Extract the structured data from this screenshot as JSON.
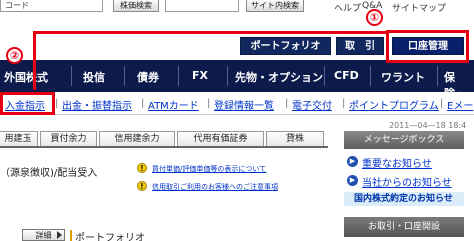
{
  "topbar": {
    "code_input_value": "コード",
    "stock_search_label": "株価検索",
    "site_search_label": "サイト内検索",
    "help": "ヘルプ",
    "qa": "Q&A",
    "sitemap": "サイトマップ"
  },
  "tabs": {
    "portfolio": "ポートフォリオ",
    "torihiki": "取　引",
    "koza": "口座管理"
  },
  "mainnav": [
    "外国株式",
    "投信",
    "債券",
    "FX",
    "先物・オプション",
    "CFD",
    "ワラント",
    "保険・"
  ],
  "subnav": [
    "入金指示",
    "出金・振替指示",
    "ATMカード",
    "登録情報一覧",
    "電子交付",
    "ポイントプログラム",
    "Eメー"
  ],
  "date": "2011―04―18 18:4",
  "section_tabs": [
    "用建玉",
    "買付余力",
    "信用建余力",
    "代用有価証券",
    "貸株"
  ],
  "content": {
    "line1": "（源泉徴収)/配当受入",
    "notice1": "買付単価/評価単価等の表示について",
    "notice2": "信用取引ご利用のお客様へのご注意事項",
    "detail_label": "詳細",
    "portfolio_title": "ポートフォリオ"
  },
  "right_panel": {
    "header": "メッセージボックス",
    "link1": "重要なお知らせ",
    "link2": "当社からのお知らせ",
    "bar": "国内株式約定のお知らせ",
    "koza_header": "お取引・口座開設"
  },
  "annotations": {
    "step1": "①",
    "step2": "②"
  },
  "colors": {
    "navy": "#0d1b4c",
    "tab_navy": "#12275e",
    "link_blue": "#0033cc",
    "annotation_red": "#e60012",
    "panel_blue": "#d9ecf8"
  }
}
